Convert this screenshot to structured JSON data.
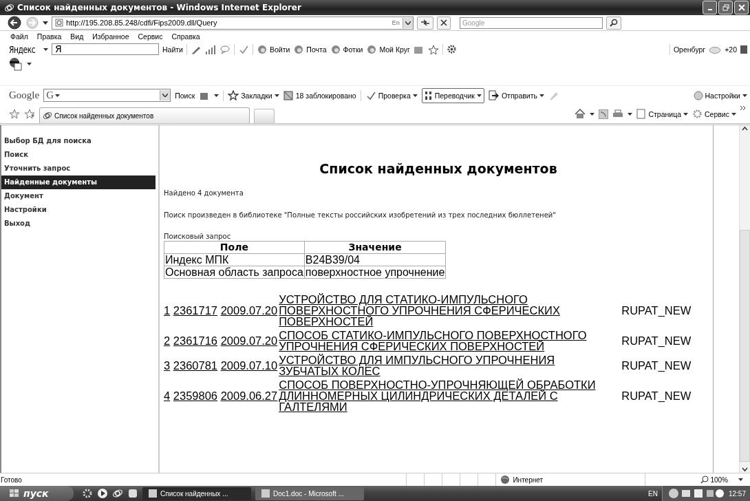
{
  "window": {
    "title": "Список найденных документов - Windows Internet Explorer"
  },
  "address_bar": {
    "url": "http://195.208.85.248/cdfi/Fips2009.dll/Query",
    "language": "En",
    "search_placeholder": "Google"
  },
  "menu": [
    "Файл",
    "Правка",
    "Вид",
    "Избранное",
    "Сервис",
    "Справка"
  ],
  "yandex_bar": {
    "logo": "Яндекс",
    "field": "Я",
    "find": "Найти",
    "buttons": [
      "Войти",
      "Почта",
      "Фотки",
      "Мой Круг"
    ],
    "city": "Оренбург",
    "temperature": "+20"
  },
  "google_bar": {
    "logo": "Google",
    "field": "G",
    "search": "Поиск",
    "bookmarks": "Закладки",
    "blocked": "18 заблокировано",
    "spellcheck": "Проверка",
    "translator": "Переводчик",
    "send": "Отправить",
    "settings": "Настройки"
  },
  "tabs": [
    {
      "label": "Список найденных документов",
      "selected": true
    }
  ],
  "command_bar": {
    "page": "Страница",
    "tools": "Сервис"
  },
  "sidebar": [
    {
      "label": "Выбор БД для поиска",
      "selected": false
    },
    {
      "label": "Поиск",
      "selected": false
    },
    {
      "label": "Уточнить запрос",
      "selected": false
    },
    {
      "label": "Найденные документы",
      "selected": true
    },
    {
      "label": "Документ",
      "selected": false
    },
    {
      "label": "Настройки",
      "selected": false
    },
    {
      "label": "Выход",
      "selected": false
    }
  ],
  "page": {
    "heading": "Список найденных документов",
    "found": "Найдено 4 документа",
    "library": "Поиск произведен в библиотеке \"Полные тексты российских изобретений из трех последних бюллетеней\"",
    "query_label": "Поисковый запрос",
    "query_table": {
      "columns": [
        "Поле",
        "Значение"
      ],
      "rows": [
        [
          "Индекс МПК",
          "B24B39/04"
        ],
        [
          "Основная область запроса",
          "поверхностное упрочнение"
        ]
      ]
    },
    "results": [
      {
        "number": "1",
        "id": "2361717",
        "date": "2009.07.20",
        "title": "УСТРОЙСТВО ДЛЯ СТАТИКО-ИМПУЛЬСНОГО ПОВЕРХНОСТНОГО УПРОЧНЕНИЯ СФЕРИЧЕСКИХ ПОВЕРХНОСТЕЙ",
        "source": "RUPAT_NEW"
      },
      {
        "number": "2",
        "id": "2361716",
        "date": "2009.07.20",
        "title": "СПОСОБ СТАТИКО-ИМПУЛЬСНОГО ПОВЕРХНОСТНОГО УПРОЧНЕНИЯ СФЕРИЧЕСКИХ ПОВЕРХНОСТЕЙ",
        "source": "RUPAT_NEW"
      },
      {
        "number": "3",
        "id": "2360781",
        "date": "2009.07.10",
        "title": "УСТРОЙСТВО ДЛЯ ИМПУЛЬСНОГО УПРОЧНЕНИЯ ЗУБЧАТЫХ КОЛЕС",
        "source": "RUPAT_NEW"
      },
      {
        "number": "4",
        "id": "2359806",
        "date": "2009.06.27",
        "title": "СПОСОБ ПОВЕРХНОСТНО-УПРОЧНЯЮЩЕЙ ОБРАБОТКИ ДЛИННОМЕРНЫХ ЦИЛИНДРИЧЕСКИХ ДЕТАЛЕЙ С ГАЛТЕЛЯМИ",
        "source": "RUPAT_NEW"
      }
    ]
  },
  "status_bar": {
    "text": "Готово",
    "zone": "Интернет",
    "zoom": "100%"
  },
  "taskbar": {
    "start": "пуск",
    "tasks": [
      {
        "label": "Список найденных ...",
        "selected": true
      },
      {
        "label": "Doc1.doc - Microsoft ...",
        "selected": false
      }
    ],
    "language": "EN",
    "clock": "12:57"
  }
}
